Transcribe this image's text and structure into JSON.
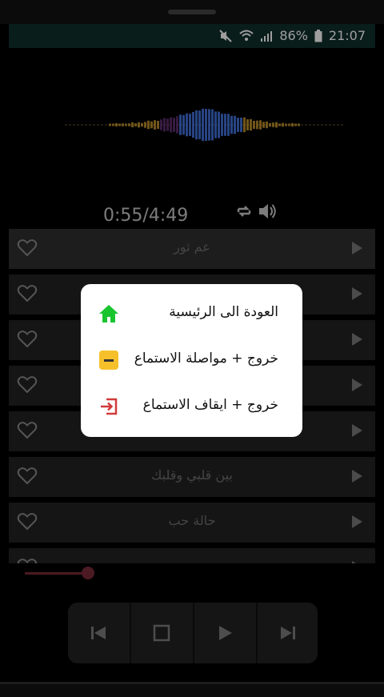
{
  "status": {
    "battery": "86%",
    "time": "21:07"
  },
  "player": {
    "time": "0:55/4:49"
  },
  "songs": [
    {
      "title": "عم ثور"
    },
    {
      "title": ""
    },
    {
      "title": ""
    },
    {
      "title": ""
    },
    {
      "title": "..."
    },
    {
      "title": "بين قلبي وقلبك"
    },
    {
      "title": "حالة حب"
    },
    {
      "title": "..."
    }
  ],
  "dialog": {
    "home": "العودة الى الرئيسية",
    "exit_continue": "خروج + مواصلة الاستماع",
    "exit_stop": "خروج + ايقاف الاستماع"
  },
  "colors": {
    "status_bar": "#0f2f2a",
    "home_icon": "#19c42f",
    "minimize_icon": "#f6c02a",
    "exit_icon": "#d23a3a",
    "seek": "#7a2a38"
  },
  "icons": [
    "mute-icon",
    "wifi-icon",
    "signal-icon",
    "battery-icon",
    "repeat-icon",
    "volume-icon",
    "heart-icon",
    "play-icon",
    "skip-previous-icon",
    "stop-icon",
    "skip-next-icon",
    "home-icon",
    "minimize-icon",
    "exit-icon"
  ]
}
